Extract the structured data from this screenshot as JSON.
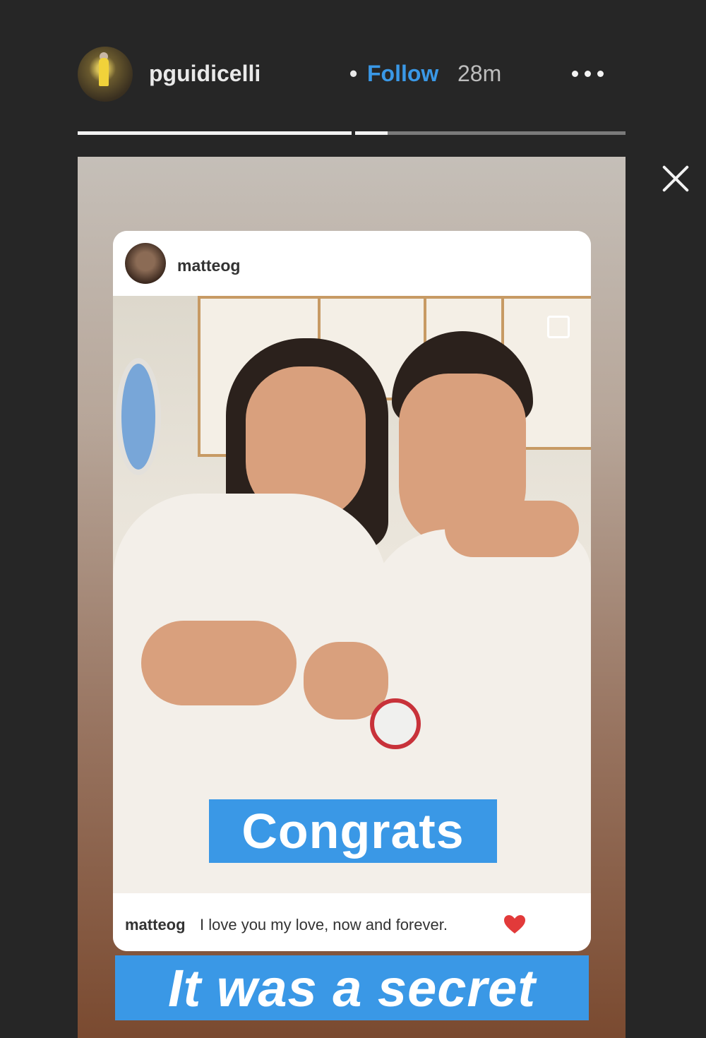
{
  "header": {
    "username": "pguidicelli",
    "separator": "•",
    "follow_label": "Follow",
    "time": "28m"
  },
  "progress": [
    {
      "progress": 1.0
    },
    {
      "progress": 0.12
    }
  ],
  "post": {
    "username": "matteog",
    "caption_user": "matteog",
    "caption_text": "I love you my love, now and forever."
  },
  "stickers": {
    "top": "Congrats",
    "bottom": "It was a secret"
  },
  "colors": {
    "background": "#262626",
    "follow": "#3a98e6",
    "sticker": "#3a98e6"
  }
}
